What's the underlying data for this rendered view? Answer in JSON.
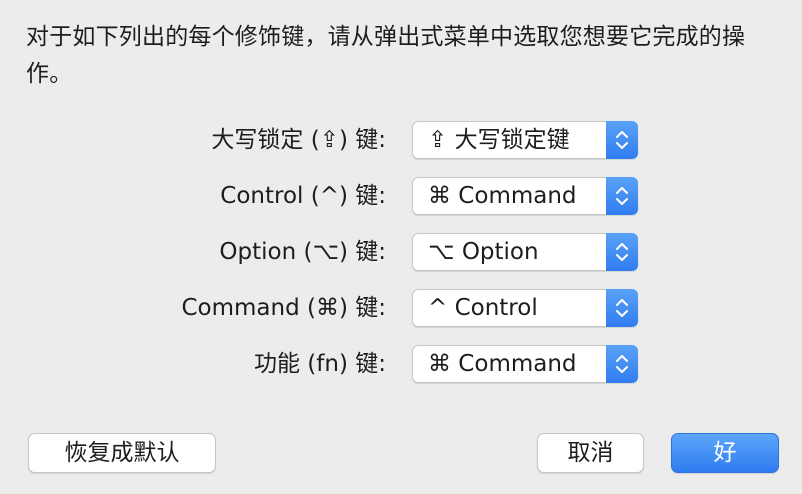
{
  "description": "对于如下列出的每个修饰键，请从弹出式菜单中选取您想要它完成的操作。",
  "rows": [
    {
      "label": "大写锁定 (⇪) 键:",
      "value": "⇪ 大写锁定键"
    },
    {
      "label": "Control (^) 键:",
      "value": "⌘ Command"
    },
    {
      "label": "Option (⌥) 键:",
      "value": "⌥ Option"
    },
    {
      "label": "Command (⌘) 键:",
      "value": "^ Control"
    },
    {
      "label": "功能 (fn) 键:",
      "value": "⌘ Command"
    }
  ],
  "buttons": {
    "restore_defaults": "恢复成默认",
    "cancel": "取消",
    "ok": "好"
  },
  "colors": {
    "accent": "#3b82f6",
    "background": "#ececec"
  },
  "icons": {
    "stepper": "chevron-up-down-icon"
  }
}
